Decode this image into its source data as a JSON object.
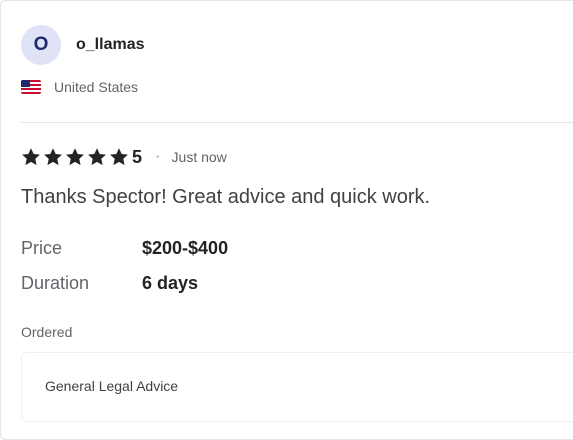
{
  "reviewer": {
    "avatar_initial": "O",
    "username": "o_llamas",
    "country": "United States",
    "flag_icon": "us-flag-icon"
  },
  "review": {
    "stars": 5,
    "rating": "5",
    "separator": "•",
    "timestamp": "Just now",
    "text": "Thanks Spector! Great advice and quick work."
  },
  "details": {
    "price_label": "Price",
    "price_value": "$200-$400",
    "duration_label": "Duration",
    "duration_value": "6 days"
  },
  "ordered": {
    "label": "Ordered",
    "service": "General Legal Advice"
  },
  "colors": {
    "star": "#222325",
    "avatar_bg": "#dfe3f5",
    "avatar_text": "#1f2a6d",
    "muted_text": "#62646a"
  }
}
